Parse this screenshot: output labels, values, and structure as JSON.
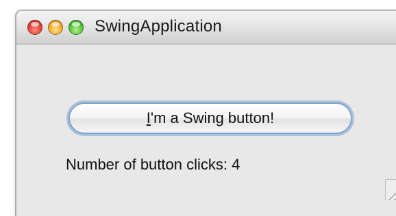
{
  "window": {
    "title": "SwingApplication",
    "controls": {
      "close_icon": "close-icon",
      "minimize_icon": "minimize-icon",
      "zoom_icon": "zoom-icon"
    },
    "colors": {
      "close": "#e0443a",
      "minimize": "#f3a72a",
      "zoom": "#55c238",
      "button_focus_ring": "#7ea3c9"
    }
  },
  "content": {
    "button": {
      "mnemonic": "I",
      "label_rest": "'m a Swing button!"
    },
    "clicks_label": "Number of button clicks: 4"
  }
}
